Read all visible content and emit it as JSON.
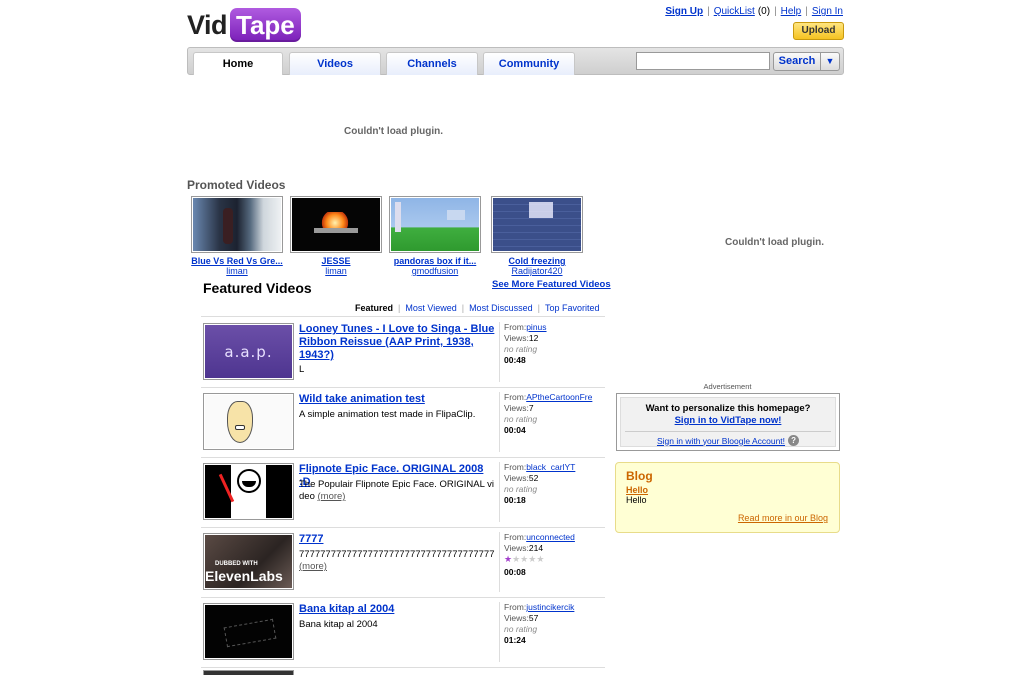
{
  "logo": {
    "part1": "Vid",
    "part2": "Tape"
  },
  "top_links": {
    "sign_up": "Sign Up",
    "quicklist": "QuickList",
    "quicklist_count": "(0)",
    "help": "Help",
    "sign_in": "Sign In",
    "sep": "|"
  },
  "upload_label": "Upload",
  "nav": {
    "tabs": [
      {
        "label": "Home"
      },
      {
        "label": "Videos"
      },
      {
        "label": "Channels"
      },
      {
        "label": "Community"
      }
    ]
  },
  "search": {
    "value": "",
    "button": "Search",
    "dropdown_icon": "▼"
  },
  "plugin_message": "Couldn't load plugin.",
  "promoted": {
    "title": "Promoted Videos",
    "items": [
      {
        "title": "Blue Vs Red Vs Gre...",
        "user": "liman"
      },
      {
        "title": "JESSE",
        "user": "liman"
      },
      {
        "title": "pandoras box if it...",
        "user": "gmodfusion"
      },
      {
        "title": "Cold freezing",
        "user": "Radijator420"
      }
    ]
  },
  "featured": {
    "title": "Featured Videos",
    "see_more": "See More Featured Videos",
    "subtabs": [
      "Featured",
      "Most Viewed",
      "Most Discussed",
      "Top Favorited"
    ],
    "from_label": "From:",
    "views_label": "Views:",
    "videos": [
      {
        "title": "Looney Tunes - I Love to Singa - Blue Ribbon Reissue (AAP Print, 1938, 1943?)",
        "desc": "L",
        "more": "",
        "user": "pinus",
        "views": "12",
        "rating": "no rating",
        "duration": "00:48",
        "thumb_text": "a.a.p."
      },
      {
        "title": "Wild take animation test",
        "desc": "A simple animation test made in FlipaClip.",
        "more": "",
        "user": "APtheCartoonFre",
        "views": "7",
        "rating": "no rating",
        "duration": "00:04",
        "thumb_text": ""
      },
      {
        "title": "Flipnote Epic Face. ORIGINAL 2008 :D",
        "desc": "The Populair Flipnote Epic Face. ORIGINAL video",
        "more": "(more)",
        "user": "black_carlYT",
        "views": "52",
        "rating": "no rating",
        "duration": "00:18",
        "thumb_text": ""
      },
      {
        "title": "7777",
        "desc": "7777777777777777777777777777777777777",
        "more": "(more)",
        "user": "unconnected",
        "views": "214",
        "rating": "",
        "stars": 1,
        "duration": "00:08",
        "thumb_text": "ElevenLabs",
        "thumb_sub": "DUBBED WITH"
      },
      {
        "title": "Bana kitap al 2004",
        "desc": "Bana kitap al 2004",
        "more": "",
        "user": "justincikercik",
        "views": "57",
        "rating": "no rating",
        "duration": "01:24",
        "thumb_text": ""
      }
    ]
  },
  "sidebar": {
    "plugin_message": "Couldn't load plugin.",
    "ad_label": "Advertisement",
    "personalize": {
      "question": "Want to personalize this homepage?",
      "sign_in_link": "Sign in to VidTape now!",
      "account_link": "Sign in with your Bloogle Account!",
      "help_icon": "?"
    },
    "blog": {
      "title": "Blog",
      "post_title": "Hello",
      "post_body": "Hello",
      "read_more": "Read more in our Blog"
    }
  },
  "colors": {
    "link": "#0033cc",
    "logo_purple": "#9b3fd6",
    "blog_orange": "#cc6600",
    "blog_bg": "#ffffd4",
    "upload_yellow": "#f5c322",
    "star_purple": "#a33fcc"
  }
}
